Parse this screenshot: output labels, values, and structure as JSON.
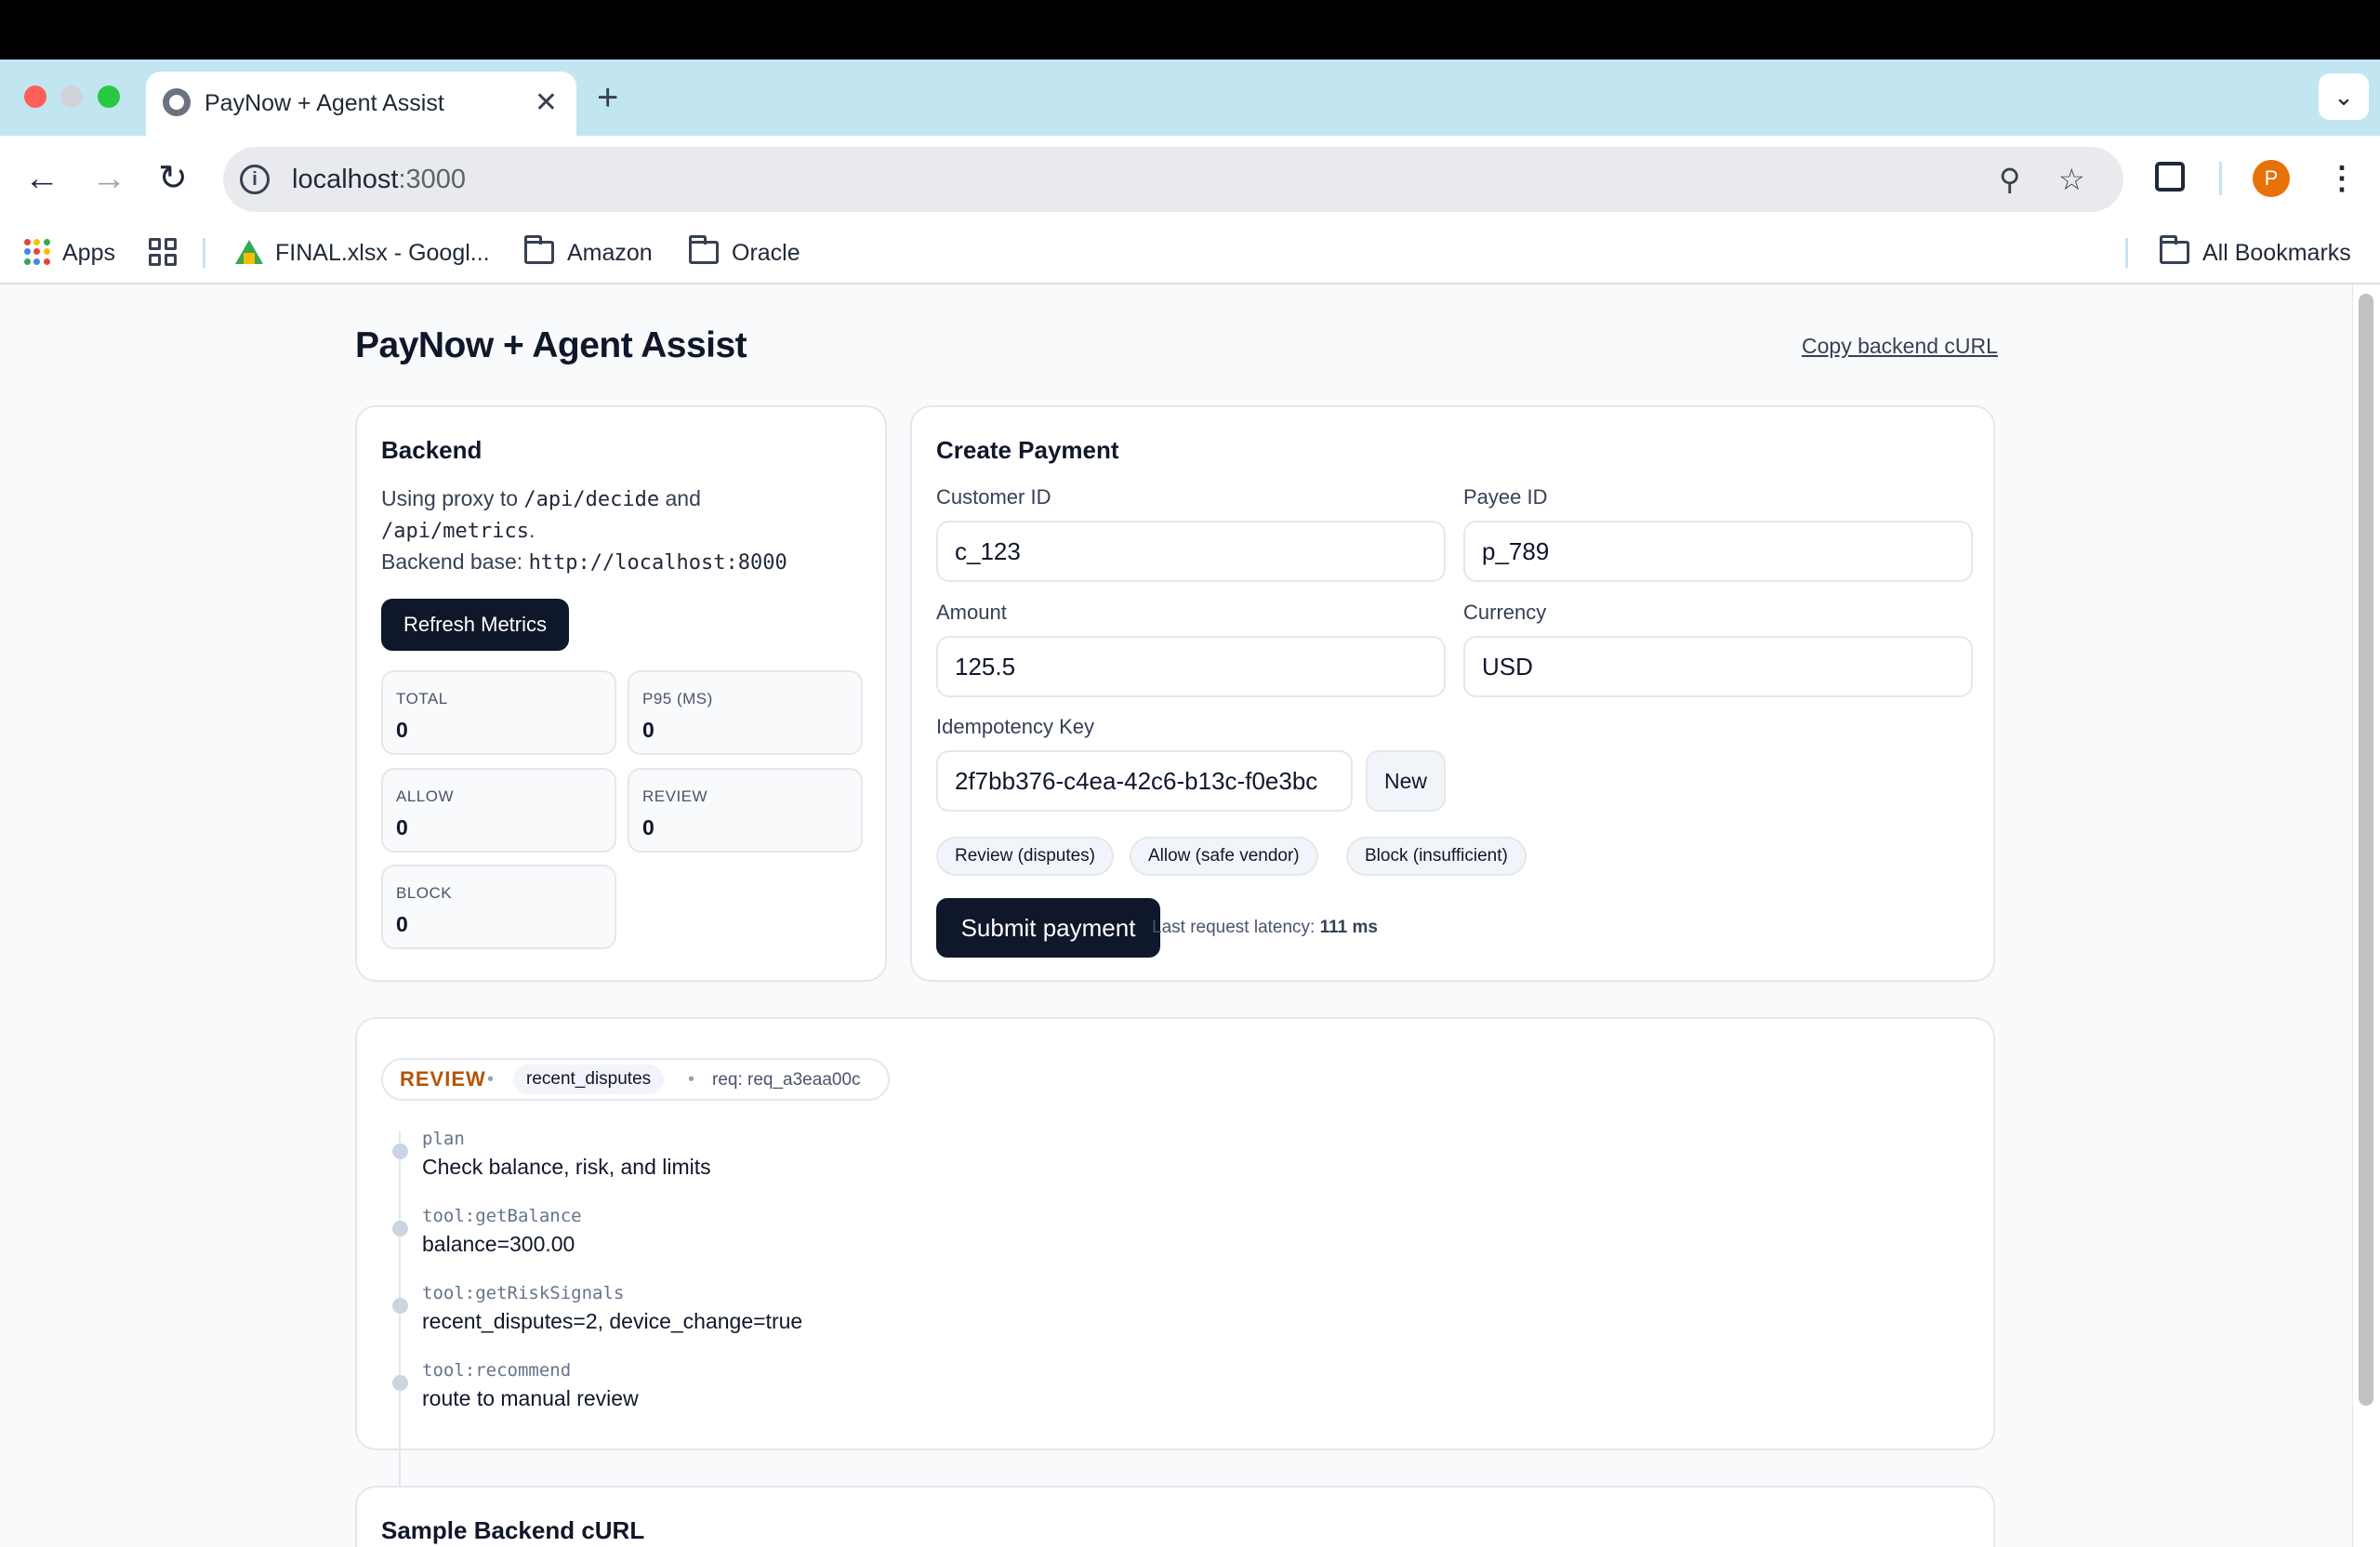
{
  "browser": {
    "tab_title": "PayNow + Agent Assist",
    "tab_close": "✕",
    "new_tab": "+",
    "tab_menu": "⌄",
    "url_host": "localhost",
    "url_port": ":3000",
    "avatar_letter": "P",
    "icons": {
      "back": "←",
      "forward": "→",
      "reload": "↻",
      "zoom": "⚲",
      "star": "☆",
      "menu": "⋮"
    },
    "bookmarks": {
      "apps": "Apps",
      "sheet": "FINAL.xlsx - Googl...",
      "folder1": "Amazon",
      "folder2": "Oracle",
      "all": "All Bookmarks"
    },
    "colors": {
      "tabstrip": "#c2e5f2",
      "avatar": "#e8710a"
    }
  },
  "app": {
    "title": "PayNow + Agent Assist",
    "copy_curl_link": "Copy backend cURL"
  },
  "backend": {
    "title": "Backend",
    "line1_prefix": "Using proxy to ",
    "path_decide": "/api/decide",
    "line1_mid": " and",
    "path_metrics": "/api/metrics",
    "line2_suffix": ".",
    "base_label": "Backend base: ",
    "base_url": "http://localhost:8000",
    "refresh_button": "Refresh Metrics",
    "metrics": {
      "total_label": "TOTAL",
      "total": "0",
      "p95_label": "P95 (MS)",
      "p95": "0",
      "allow_label": "ALLOW",
      "allow": "0",
      "review_label": "REVIEW",
      "review": "0",
      "block_label": "BLOCK",
      "block": "0"
    }
  },
  "payment": {
    "title": "Create Payment",
    "customer_label": "Customer ID",
    "customer_value": "c_123",
    "payee_label": "Payee ID",
    "payee_value": "p_789",
    "amount_label": "Amount",
    "amount_value": "125.5",
    "currency_label": "Currency",
    "currency_value": "USD",
    "idem_label": "Idempotency Key",
    "idem_value": "2f7bb376-c4ea-42c6-b13c-f0e3bc",
    "new_button": "New",
    "presets": [
      "Review (disputes)",
      "Allow (safe vendor)",
      "Block (insufficient)"
    ],
    "submit_button": "Submit payment",
    "latency_label": "Last request latency: ",
    "latency_value": "111 ms"
  },
  "decision": {
    "label": "REVIEW",
    "reason": "recent_disputes",
    "separator": "•",
    "req": "req: req_a3eaa00c",
    "steps": [
      {
        "tag": "plan",
        "text": "Check balance, risk, and limits"
      },
      {
        "tag": "tool:getBalance",
        "text": "balance=300.00"
      },
      {
        "tag": "tool:getRiskSignals",
        "text": "recent_disputes=2, device_change=true"
      },
      {
        "tag": "tool:recommend",
        "text": "route to manual review"
      }
    ],
    "colors": {
      "review": "#b45309"
    }
  },
  "sample": {
    "title": "Sample Backend cURL"
  }
}
